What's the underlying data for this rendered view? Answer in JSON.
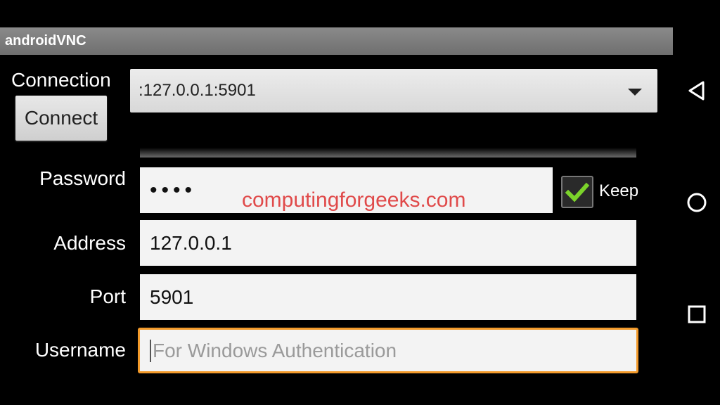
{
  "app": {
    "title": "androidVNC"
  },
  "connection": {
    "label": "Connection",
    "connect_button": "Connect",
    "selected": ":127.0.0.1:5901"
  },
  "form": {
    "password": {
      "label": "Password",
      "value": "••••"
    },
    "keep": {
      "label": "Keep",
      "checked": true
    },
    "address": {
      "label": "Address",
      "value": "127.0.0.1"
    },
    "port": {
      "label": "Port",
      "value": "5901"
    },
    "username": {
      "label": "Username",
      "placeholder": "For Windows Authentication",
      "value": ""
    }
  },
  "watermark": "computingforgeeks.com",
  "colors": {
    "focus_border": "#f39a2a",
    "check": "#7bd32a",
    "watermark": "#e04a4a"
  },
  "nav": {
    "icons": [
      "back-icon",
      "home-icon",
      "recents-icon"
    ]
  }
}
